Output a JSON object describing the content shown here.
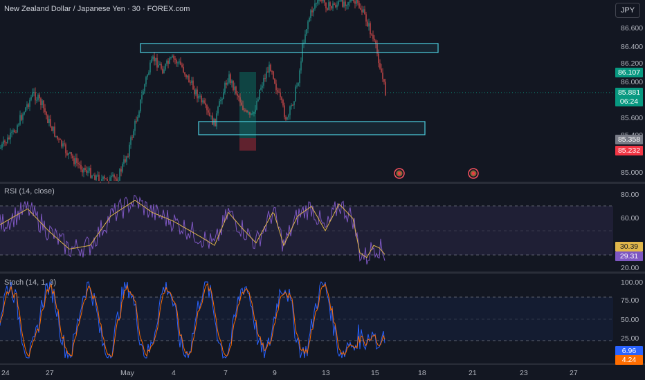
{
  "header": {
    "title": "New Zealand Dollar / Japanese Yen · 30 · FOREX.com",
    "currency": "JPY"
  },
  "price_axis": {
    "ticks": [
      "86.600",
      "86.400",
      "86.200",
      "86.000",
      "85.600",
      "85.400",
      "85.000"
    ]
  },
  "price_tags": [
    {
      "label": "86.107",
      "bg": "#089981",
      "fg": "#ffffff"
    },
    {
      "label": "85.881",
      "bg": "#089981",
      "fg": "#ffffff"
    },
    {
      "label": "06:24",
      "bg": "#089981",
      "fg": "#ffffff"
    },
    {
      "label": "85.358",
      "bg": "#787b86",
      "fg": "#ffffff"
    },
    {
      "label": "85.232",
      "bg": "#f23645",
      "fg": "#ffffff"
    }
  ],
  "rsi": {
    "label": "RSI (14, close)",
    "ticks": [
      "80.00",
      "60.00",
      "20.00"
    ],
    "tags": [
      {
        "label": "30.39",
        "bg": "#e0b64b",
        "fg": "#131722"
      },
      {
        "label": "29.31",
        "bg": "#7e57c2",
        "fg": "#ffffff"
      }
    ]
  },
  "stoch": {
    "label": "Stoch (14, 1, 3)",
    "ticks": [
      "100.00",
      "75.00",
      "50.00",
      "25.00"
    ],
    "tags": [
      {
        "label": "6.96",
        "bg": "#2962ff",
        "fg": "#ffffff"
      },
      {
        "label": "4.24",
        "bg": "#ff6d00",
        "fg": "#ffffff"
      }
    ]
  },
  "time_axis": {
    "labels": [
      "24",
      "27",
      "May",
      "4",
      "7",
      "9",
      "13",
      "15",
      "18",
      "21",
      "23",
      "27"
    ]
  },
  "colors": {
    "up": "#26a69a",
    "down": "#ef5350",
    "zone": "#4dd0e1",
    "rsi": "#7e57c2",
    "rsi_ma": "#e0b64b",
    "stoch_k": "#2962ff",
    "stoch_d": "#ff6d00"
  },
  "icons": [
    "event-marker-icon",
    "event-marker-icon"
  ]
}
